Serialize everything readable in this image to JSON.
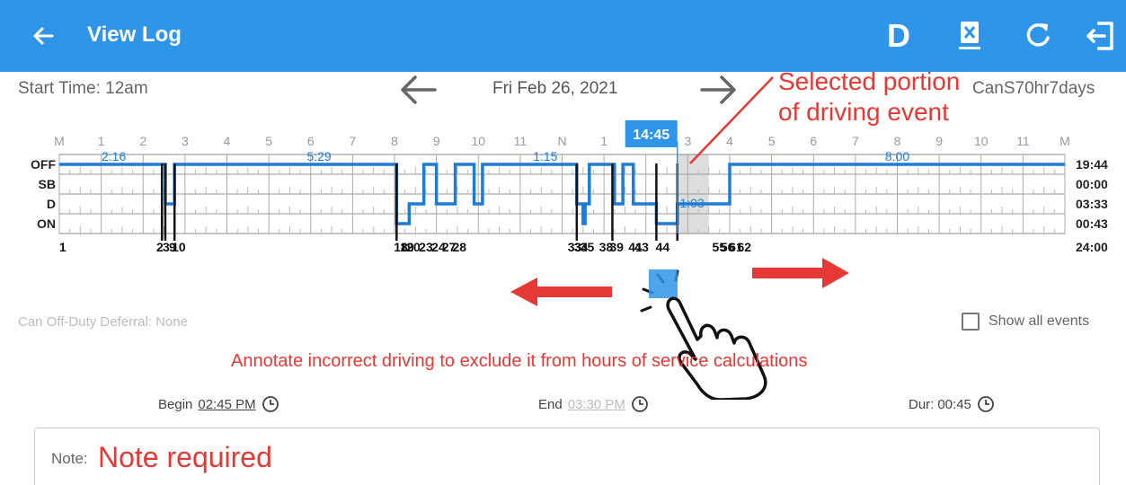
{
  "appbar": {
    "title": "View Log",
    "d_label": "D",
    "icons": [
      "back-arrow-icon",
      "device-x-icon",
      "refresh-icon",
      "exit-icon"
    ]
  },
  "header": {
    "start_time": "Start Time: 12am",
    "date": "Fri Feb 26, 2021",
    "ruleset": "CanS70hr7days"
  },
  "callout": {
    "line1": "Selected portion",
    "line2": "of driving event"
  },
  "graph": {
    "hour_labels": [
      "M",
      "1",
      "2",
      "3",
      "4",
      "5",
      "6",
      "7",
      "8",
      "9",
      "10",
      "11",
      "N",
      "1",
      "2",
      "3",
      "4",
      "5",
      "6",
      "7",
      "8",
      "9",
      "10",
      "11",
      "M"
    ],
    "rows": [
      "OFF",
      "SB",
      "D",
      "ON"
    ],
    "totals": [
      "19:44",
      "00:00",
      "03:33",
      "00:43"
    ],
    "total_hours": "24:00",
    "selected_time": "14:45",
    "duration_labels": [
      "2:16",
      "5:29",
      "1:15",
      "1:03",
      "8:00"
    ],
    "event_numbers_text": [
      "1",
      "2",
      "3",
      "9",
      "10",
      "18",
      "19",
      "20",
      "23",
      "24",
      "27",
      "28",
      "33",
      "34",
      "35",
      "38",
      "39",
      "41",
      "43",
      "44",
      "55",
      "56",
      "61",
      "62"
    ],
    "status_segments": [
      {
        "from": 0,
        "to": 2.53,
        "status": "OFF"
      },
      {
        "from": 2.53,
        "to": 2.75,
        "status": "D"
      },
      {
        "from": 2.75,
        "to": 8.05,
        "status": "OFF"
      },
      {
        "from": 8.05,
        "to": 8.2,
        "status": "ON"
      },
      {
        "from": 8.2,
        "to": 8.35,
        "status": "ON"
      },
      {
        "from": 8.35,
        "to": 8.7,
        "status": "D"
      },
      {
        "from": 8.7,
        "to": 9.0,
        "status": "OFF"
      },
      {
        "from": 9.0,
        "to": 9.2,
        "status": "D"
      },
      {
        "from": 9.2,
        "to": 9.45,
        "status": "D"
      },
      {
        "from": 9.45,
        "to": 9.9,
        "status": "OFF"
      },
      {
        "from": 9.9,
        "to": 10.1,
        "status": "D"
      },
      {
        "from": 10.1,
        "to": 12.35,
        "status": "OFF"
      },
      {
        "from": 12.35,
        "to": 12.5,
        "status": "D"
      },
      {
        "from": 12.5,
        "to": 12.55,
        "status": "ON"
      },
      {
        "from": 12.55,
        "to": 12.65,
        "status": "D"
      },
      {
        "from": 12.65,
        "to": 12.85,
        "status": "OFF"
      },
      {
        "from": 12.85,
        "to": 13.25,
        "status": "OFF"
      },
      {
        "from": 13.25,
        "to": 13.45,
        "status": "D"
      },
      {
        "from": 13.45,
        "to": 13.7,
        "status": "OFF"
      },
      {
        "from": 13.7,
        "to": 14.25,
        "status": "D"
      },
      {
        "from": 14.25,
        "to": 14.75,
        "status": "ON"
      },
      {
        "from": 14.75,
        "to": 15.5,
        "status": "D"
      },
      {
        "from": 15.5,
        "to": 16.0,
        "status": "D"
      },
      {
        "from": 16.0,
        "to": 24,
        "status": "OFF"
      }
    ],
    "selection": {
      "from": 14.75,
      "to": 15.5
    }
  },
  "deferral": "Can Off-Duty Deferral: None",
  "show_all_events": "Show all events",
  "annotation": "Annotate incorrect driving to exclude it from hours of service calculations",
  "times": {
    "begin_label": "Begin",
    "begin_value": "02:45 PM",
    "end_label": "End",
    "end_value": "03:30 PM",
    "dur_label": "Dur:",
    "dur_value": "00:45"
  },
  "note": {
    "label": "Note:",
    "required": "Note required"
  },
  "colors": {
    "appbar": "#2f95e8",
    "status_line": "#1e7bd6",
    "selection": "#dddddd",
    "annotation": "#e53935"
  }
}
